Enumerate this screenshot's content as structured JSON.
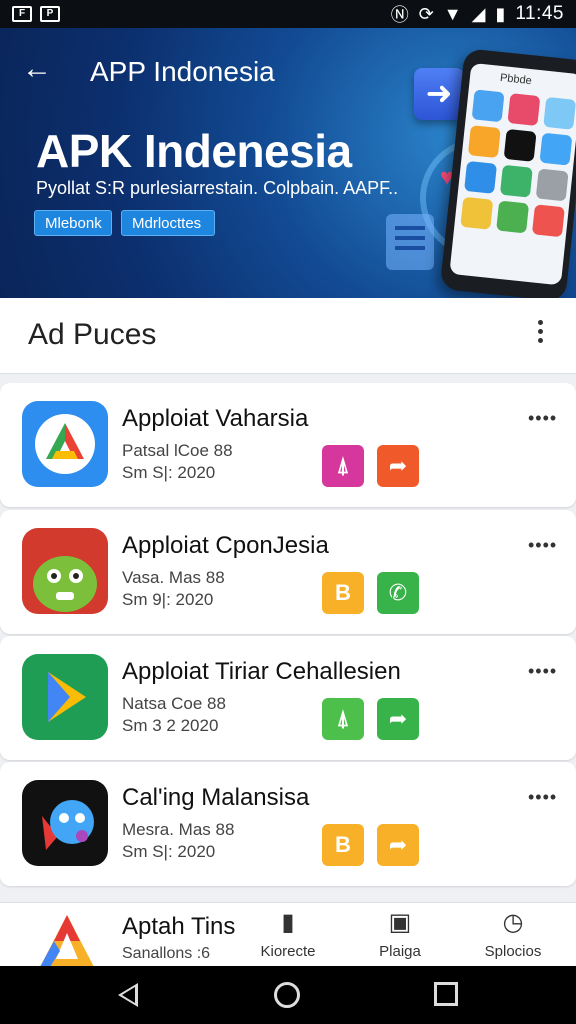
{
  "status_bar": {
    "left_icons": [
      "F",
      "P"
    ],
    "right_icons": [
      "nfc-icon",
      "sync-icon",
      "wifi-icon",
      "signal-icon",
      "battery-icon"
    ],
    "time": "11:45"
  },
  "header": {
    "title": "APP Indonesia",
    "hero_title": "APK Indenesia",
    "hero_subtitle": "Pyollat S:R purlesiarrestain. Colpbain. AAPF..",
    "chips": [
      "Mlebonk",
      "Mdrlocttes"
    ],
    "phone_label": "Pbbde"
  },
  "section": {
    "title": "Ad Puces"
  },
  "apps": [
    {
      "name": "Apploiat Vaharsia",
      "meta1": "Patsal lCoe 88",
      "meta2": "Sm S|: 2020",
      "actions": [
        {
          "icon": "bell-icon",
          "glyph": "⍋",
          "color": "#d6379c"
        },
        {
          "icon": "share-icon",
          "glyph": "➦",
          "color": "#f05a2a"
        }
      ]
    },
    {
      "name": "Apploiat CponJesia",
      "meta1": "Vasa. Mas 88",
      "meta2": "Sm 9|: 2020",
      "actions": [
        {
          "icon": "book-icon",
          "glyph": "B",
          "color": "#f7b027"
        },
        {
          "icon": "phone-icon",
          "glyph": "✆",
          "color": "#37b34a"
        }
      ]
    },
    {
      "name": "Apploiat Tiriar Cehallesien",
      "meta1": "Natsa Coe 88",
      "meta2": "Sm 3 2 2020",
      "actions": [
        {
          "icon": "bell-icon",
          "glyph": "⍋",
          "color": "#4cc04a"
        },
        {
          "icon": "share-icon",
          "glyph": "➦",
          "color": "#37b34a"
        }
      ]
    },
    {
      "name": "Cal'ing Malansisa",
      "meta1": "Mesra. Mas 88",
      "meta2": "Sm S|: 2020",
      "actions": [
        {
          "icon": "book-icon",
          "glyph": "B",
          "color": "#f7b027"
        },
        {
          "icon": "share-icon",
          "glyph": "➦",
          "color": "#f7b027"
        }
      ]
    }
  ],
  "bottom": {
    "title": "Aptah Tins",
    "subtitle": "Sanallons :6",
    "nav": [
      {
        "label": "Kiorecte",
        "icon": "clipboard-icon",
        "glyph": "▮"
      },
      {
        "label": "Plaiga",
        "icon": "media-icon",
        "glyph": "▣"
      },
      {
        "label": "Splocios",
        "icon": "timer-icon",
        "glyph": "◷"
      }
    ]
  }
}
